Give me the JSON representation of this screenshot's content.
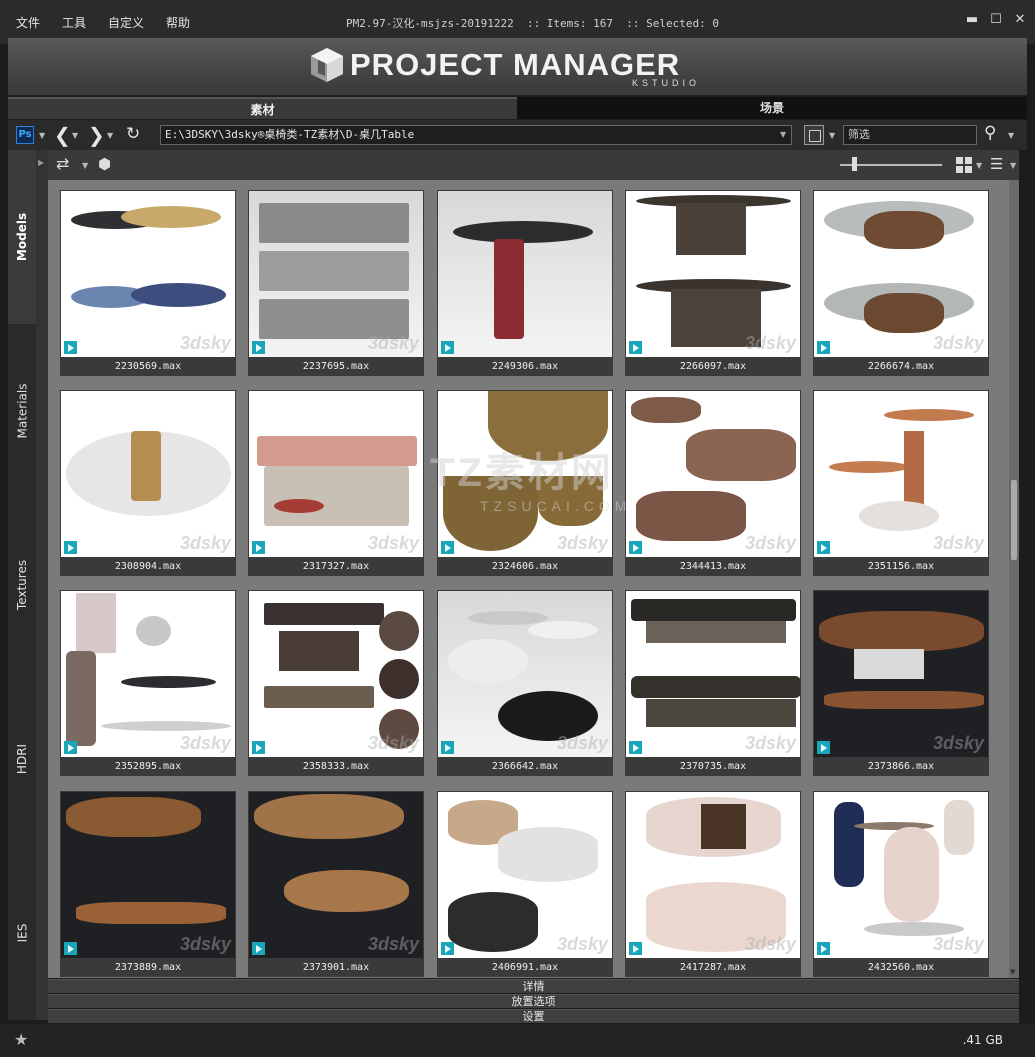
{
  "menu": [
    "文件",
    "工具",
    "自定义",
    "帮助"
  ],
  "window": {
    "title": "PM2.97-汉化-msjzs-20191222  :: Items: 167  :: Selected: 0",
    "controls": [
      "close-minimize",
      "maximize",
      "close"
    ]
  },
  "banner": {
    "logo_text": "PROJECT MANAGER",
    "logo_sub": "KSTUDIO"
  },
  "tabs": [
    {
      "label": "素材",
      "active": true
    },
    {
      "label": "场景",
      "active": false
    }
  ],
  "nav": {
    "ps_label": "Ps",
    "path": "E:\\3DSKY\\3dsky®桌椅类-TZ素材\\D-桌几Table",
    "search_placeholder": "筛选"
  },
  "side_tabs": [
    {
      "label": "Models",
      "active": true
    },
    {
      "label": "Materials",
      "active": false
    },
    {
      "label": "Textures",
      "active": false
    },
    {
      "label": "HDRI",
      "active": false
    },
    {
      "label": "IES",
      "active": false
    }
  ],
  "items": [
    {
      "file": "2230569.max",
      "bg": "light",
      "watermark": "3dsky"
    },
    {
      "file": "2237695.max",
      "bg": "grey",
      "watermark": "3dsky"
    },
    {
      "file": "2249306.max",
      "bg": "grey",
      "watermark": ""
    },
    {
      "file": "2266097.max",
      "bg": "light",
      "watermark": "3dsky"
    },
    {
      "file": "2266674.max",
      "bg": "light",
      "watermark": "3dsky"
    },
    {
      "file": "2308904.max",
      "bg": "light",
      "watermark": "3dsky"
    },
    {
      "file": "2317327.max",
      "bg": "light",
      "watermark": "3dsky"
    },
    {
      "file": "2324606.max",
      "bg": "light",
      "watermark": "3dsky"
    },
    {
      "file": "2344413.max",
      "bg": "light",
      "watermark": "3dsky"
    },
    {
      "file": "2351156.max",
      "bg": "light",
      "watermark": "3dsky"
    },
    {
      "file": "2352895.max",
      "bg": "light",
      "watermark": "3dsky"
    },
    {
      "file": "2358333.max",
      "bg": "light",
      "watermark": "3dsky"
    },
    {
      "file": "2366642.max",
      "bg": "grey",
      "watermark": "3dsky"
    },
    {
      "file": "2370735.max",
      "bg": "light",
      "watermark": "3dsky"
    },
    {
      "file": "2373866.max",
      "bg": "dark",
      "watermark": "3dsky"
    },
    {
      "file": "2373889.max",
      "bg": "dark",
      "watermark": "3dsky"
    },
    {
      "file": "2373901.max",
      "bg": "dark",
      "watermark": "3dsky"
    },
    {
      "file": "2406991.max",
      "bg": "light",
      "watermark": "3dsky"
    },
    {
      "file": "2417287.max",
      "bg": "light",
      "watermark": "3dsky"
    },
    {
      "file": "2432560.max",
      "bg": "light",
      "watermark": "3dsky"
    }
  ],
  "overlay_watermark": {
    "line1": "TZ素材网",
    "line2": "TZSUCAI.COM"
  },
  "panels": [
    "详情",
    "放置选项",
    "设置"
  ],
  "status": {
    "size": ".41 GB"
  }
}
